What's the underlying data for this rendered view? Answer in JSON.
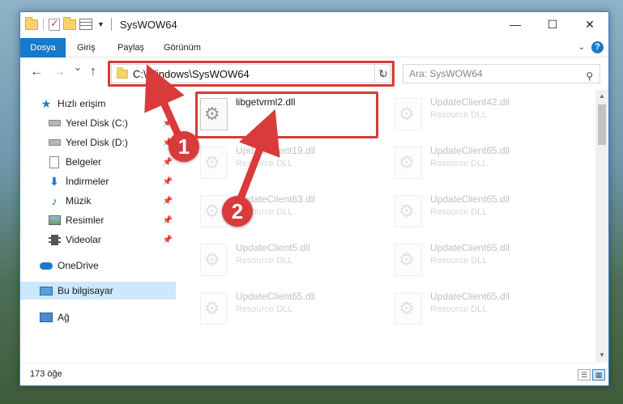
{
  "window": {
    "title": "SysWOW64",
    "minimize_glyph": "—",
    "maximize_glyph": "☐",
    "close_glyph": "✕"
  },
  "ribbon": {
    "tabs": [
      "Dosya",
      "Giriş",
      "Paylaş",
      "Görünüm"
    ],
    "help_glyph": "?"
  },
  "navigation": {
    "back_glyph": "←",
    "forward_glyph": "→",
    "recent_glyph": "⌄",
    "up_glyph": "↑",
    "address": "C:\\Windows\\SysWOW64",
    "refresh_glyph": "↻",
    "search_placeholder": "Ara: SysWOW64"
  },
  "sidebar": {
    "items": [
      {
        "label": "Hızlı erişim",
        "icon": "star-icon",
        "pinned": false
      },
      {
        "label": "Yerel Disk (C:)",
        "icon": "disk-icon",
        "pinned": true
      },
      {
        "label": "Yerel Disk (D:)",
        "icon": "disk-icon",
        "pinned": true
      },
      {
        "label": "Belgeler",
        "icon": "documents-icon",
        "pinned": true
      },
      {
        "label": "İndirmeler",
        "icon": "downloads-icon",
        "pinned": true
      },
      {
        "label": "Müzik",
        "icon": "music-icon",
        "pinned": true
      },
      {
        "label": "Resimler",
        "icon": "pictures-icon",
        "pinned": true
      },
      {
        "label": "Videolar",
        "icon": "videos-icon",
        "pinned": true
      },
      {
        "label": "OneDrive",
        "icon": "onedrive-icon",
        "pinned": false
      },
      {
        "label": "Bu bilgisayar",
        "icon": "computer-icon",
        "pinned": false
      },
      {
        "label": "Ağ",
        "icon": "network-icon",
        "pinned": false
      }
    ]
  },
  "files": [
    {
      "name": "libgetvrml2.dll",
      "type": "",
      "highlighted": true
    },
    {
      "name": "UpdateClient42.dll",
      "type": "Resource DLL"
    },
    {
      "name": "UpdateClient19.dll",
      "type": "Resource DLL"
    },
    {
      "name": "UpdateClient65.dll",
      "type": "Resource DLL"
    },
    {
      "name": "UpdateClient63.dll",
      "type": "Resource DLL"
    },
    {
      "name": "UpdateClient65.dll",
      "type": "Resource DLL"
    },
    {
      "name": "UpdateClient5.dll",
      "type": "Resource DLL"
    },
    {
      "name": "UpdateClient65.dll",
      "type": "Resource DLL"
    },
    {
      "name": "UpdateClient65.dll",
      "type": "Resource DLL"
    },
    {
      "name": "UpdateClient65.dll",
      "type": "Resource DLL"
    }
  ],
  "status": {
    "item_count": "173 öğe"
  },
  "annotations": {
    "step1": "1",
    "step2": "2",
    "color": "#d93a3a"
  }
}
